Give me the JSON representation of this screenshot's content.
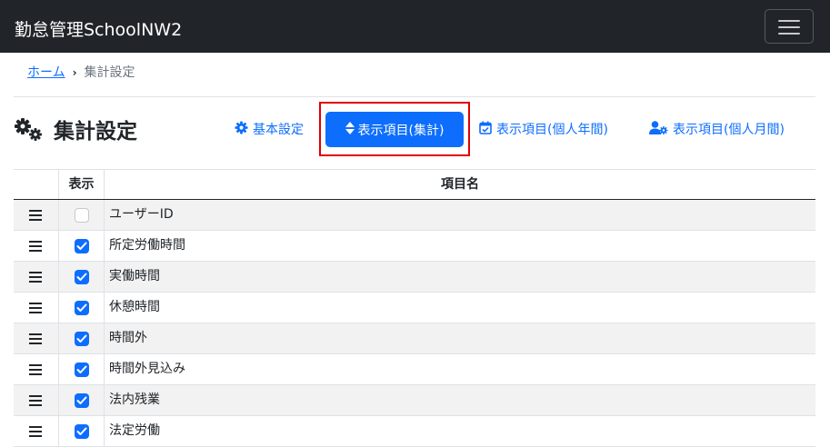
{
  "navbar": {
    "brand": "勤怠管理SchoolNW2",
    "toggler_icon": "hamburger-icon"
  },
  "breadcrumb": {
    "home": "ホーム",
    "separator": "›",
    "current": "集計設定"
  },
  "page": {
    "title": "集計設定",
    "title_icon": "gears-icon"
  },
  "tabs": [
    {
      "label": "基本設定",
      "icon": "gear-icon",
      "active": false
    },
    {
      "label": "表示項目(集計)",
      "icon": "sort-icon",
      "active": true
    },
    {
      "label": "表示項目(個人年間)",
      "icon": "calendar-check-icon",
      "active": false
    },
    {
      "label": "表示項目(個人月間)",
      "icon": "user-gear-icon",
      "active": false
    }
  ],
  "table": {
    "headers": {
      "handle": "",
      "display": "表示",
      "name": "項目名"
    },
    "rows": [
      {
        "name": "ユーザーID",
        "checked": false
      },
      {
        "name": "所定労働時間",
        "checked": true
      },
      {
        "name": "実働時間",
        "checked": true
      },
      {
        "name": "休憩時間",
        "checked": true
      },
      {
        "name": "時間外",
        "checked": true
      },
      {
        "name": "時間外見込み",
        "checked": true
      },
      {
        "name": "法内残業",
        "checked": true
      },
      {
        "name": "法定労働",
        "checked": true
      }
    ]
  },
  "colors": {
    "navbar_bg": "#212529",
    "primary": "#0d6efd",
    "highlight_border": "#e00000",
    "stripe": "#f2f2f2"
  }
}
